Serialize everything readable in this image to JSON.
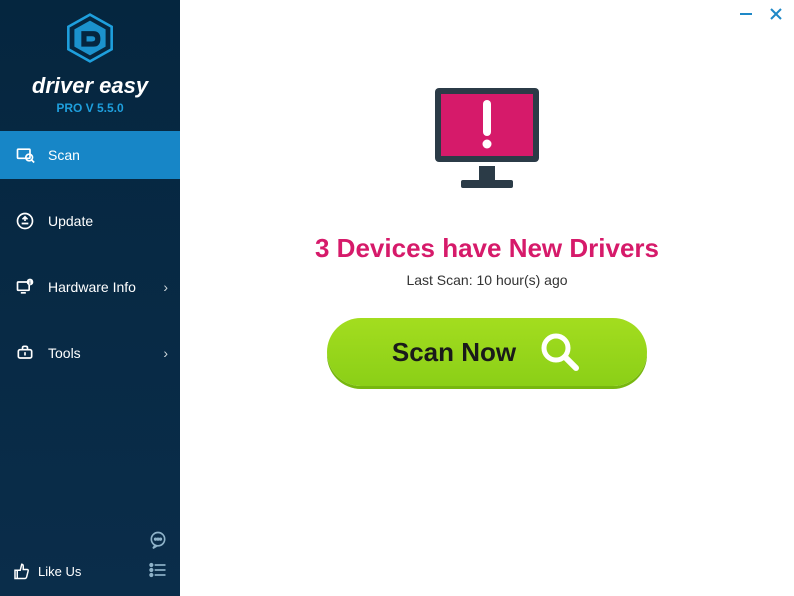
{
  "brand": {
    "name": "driver easy",
    "version": "PRO V 5.5.0"
  },
  "nav": {
    "scan": "Scan",
    "update": "Update",
    "hardware": "Hardware Info",
    "tools": "Tools"
  },
  "footer": {
    "like": "Like Us"
  },
  "main": {
    "headline": "3 Devices have New Drivers",
    "last_scan": "Last Scan: 10 hour(s) ago",
    "scan_button": "Scan Now"
  },
  "colors": {
    "accent_pink": "#d61a6a",
    "accent_blue": "#1786c7",
    "accent_green": "#8bcf17"
  }
}
